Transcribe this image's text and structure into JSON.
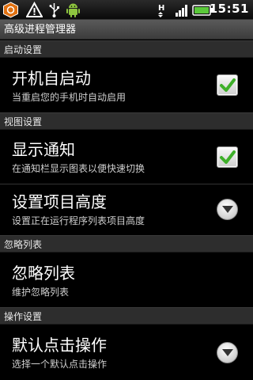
{
  "status_bar": {
    "time": "15:51",
    "icons": [
      "app-notification-icon",
      "warning-icon",
      "usb-icon",
      "android-icon",
      "h-network-icon",
      "signal-icon",
      "battery-icon"
    ]
  },
  "app": {
    "title": "高级进程管理器"
  },
  "sections": [
    {
      "header": "启动设置",
      "items": [
        {
          "title": "开机自启动",
          "summary": "当重启您的手机时自动启用",
          "control": "checkbox",
          "checked": true
        }
      ]
    },
    {
      "header": "视图设置",
      "items": [
        {
          "title": "显示通知",
          "summary": "在通知栏显示图表以便快速切换",
          "control": "checkbox",
          "checked": true
        },
        {
          "title": "设置项目高度",
          "summary": "设置正在运行程序列表项目高度",
          "control": "dropdown"
        }
      ]
    },
    {
      "header": "忽略列表",
      "items": [
        {
          "title": "忽略列表",
          "summary": "维护忽略列表",
          "control": "none"
        }
      ]
    },
    {
      "header": "操作设置",
      "items": [
        {
          "title": "默认点击操作",
          "summary": "选择一个默认点击操作",
          "control": "dropdown"
        }
      ]
    }
  ],
  "colors": {
    "check_green": "#3fb02a",
    "background": "#000000"
  }
}
